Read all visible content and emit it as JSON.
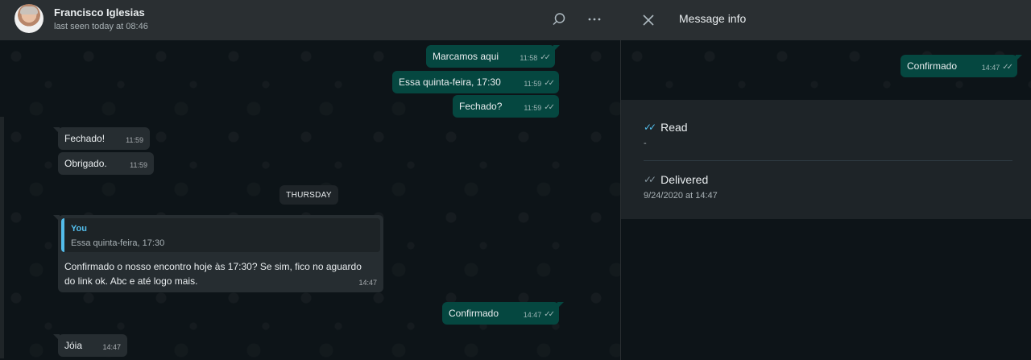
{
  "chat": {
    "contact_name": "Francisco Iglesias",
    "contact_status": "last seen today at 08:46",
    "header_icons": [
      "search-icon",
      "menu-icon"
    ],
    "messages": [
      {
        "dir": "out",
        "text": "Marcamos aqui",
        "time": "11:58"
      },
      {
        "dir": "out",
        "text": "Essa quinta-feira, 17:30",
        "time": "11:59"
      },
      {
        "dir": "out",
        "text": "Fechado?",
        "time": "11:59"
      },
      {
        "dir": "in",
        "text": "Fechado!",
        "time": "11:59"
      },
      {
        "dir": "in",
        "text": "Obrigado.",
        "time": "11:59"
      },
      {
        "dir": "in",
        "quote_author": "You",
        "quote_text": "Essa quinta-feira, 17:30",
        "text_line1": "Confirmado o nosso encontro hoje às 17:30? Se sim, fico no aguardo",
        "text_line2": "do link ok. Abc e até logo mais.",
        "time": "14:47"
      },
      {
        "dir": "out",
        "text": "Confirmado",
        "time": "14:47"
      },
      {
        "dir": "in",
        "text": "Jóia",
        "time": "14:47"
      }
    ],
    "day_separator": "THURSDAY"
  },
  "info": {
    "title": "Message info",
    "preview": {
      "text": "Confirmado",
      "time": "14:47"
    },
    "read": {
      "label": "Read",
      "value": "-"
    },
    "delivered": {
      "label": "Delivered",
      "value": "9/24/2020 at 14:47"
    }
  },
  "colors": {
    "outgoing_bubble": "#054740",
    "incoming_bubble": "#262d31",
    "header": "#2a2f32",
    "read_tick": "#53bdeb"
  }
}
